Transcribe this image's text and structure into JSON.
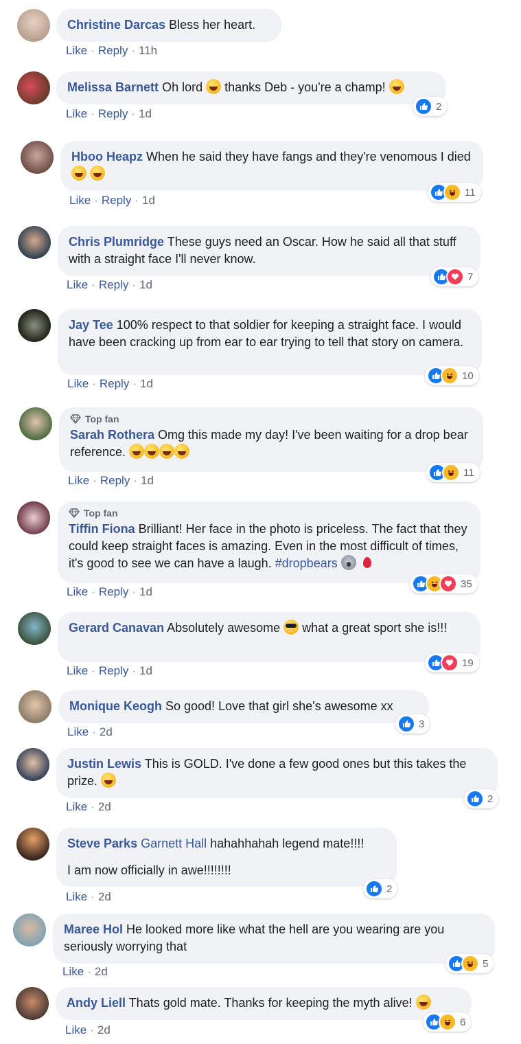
{
  "comments": [
    {
      "name": "Christine Darcas",
      "text": " Bless her heart.",
      "like": "Like",
      "reply": "Reply",
      "time": "11h",
      "reactions": null
    },
    {
      "name": "Melissa Barnett",
      "text": " Oh lord ",
      "text2": " thanks Deb - you're a champ! ",
      "like": "Like",
      "reply": "Reply",
      "time": "1d",
      "reactions": {
        "count": "2"
      }
    },
    {
      "name": "Hboo Heapz",
      "text": " When he said they have fangs and they're venomous I died ",
      "like": "Like",
      "reply": "Reply",
      "time": "1d",
      "reactions": {
        "count": "11"
      }
    },
    {
      "name": "Chris Plumridge",
      "text": " These guys need an Oscar. How he said all that stuff with a straight face I'll never know.",
      "like": "Like",
      "reply": "Reply",
      "time": "1d",
      "reactions": {
        "count": "7"
      }
    },
    {
      "name": "Jay Tee",
      "text": " 100% respect to that soldier for keeping a straight face. I would have been cracking up from ear to ear trying to tell that story on camera.",
      "like": "Like",
      "reply": "Reply",
      "time": "1d",
      "reactions": {
        "count": "10"
      }
    },
    {
      "badge": "Top fan",
      "name": "Sarah Rothera",
      "text": " Omg this made my day! I've been waiting for a drop bear reference. ",
      "like": "Like",
      "reply": "Reply",
      "time": "1d",
      "reactions": {
        "count": "11"
      }
    },
    {
      "badge": "Top fan",
      "name": "Tiffin Fiona",
      "text": " Brilliant! Her face in the photo is priceless. The fact that they could keep straight faces is amazing. Even in the most difficult of times, it's good to see we can have a laugh. ",
      "hashtag": "#dropbears",
      "like": "Like",
      "reply": "Reply",
      "time": "1d",
      "reactions": {
        "count": "35"
      }
    },
    {
      "name": "Gerard Canavan",
      "text": " Absolutely awesome ",
      "text2": " what a great sport she is!!!",
      "like": "Like",
      "reply": "Reply",
      "time": "1d",
      "reactions": {
        "count": "19"
      }
    },
    {
      "name": "Monique Keogh",
      "text": " So good! Love that girl she's awesome xx",
      "like": "Like",
      "time": "2d",
      "reactions": {
        "count": "3"
      }
    },
    {
      "name": "Justin Lewis",
      "text": " This is GOLD. I've done a few good ones but this takes the prize. ",
      "like": "Like",
      "time": "2d",
      "reactions": {
        "count": "2"
      }
    },
    {
      "name": "Steve Parks",
      "mention": "Garnett Hall",
      "text": " hahahhahah legend mate!!!!",
      "text2": "I am now officially in awe!!!!!!!!",
      "like": "Like",
      "time": "2d",
      "reactions": {
        "count": "2"
      }
    },
    {
      "name": "Maree Hol",
      "text": " He looked more like what the hell are you wearing are you seriously worrying that",
      "like": "Like",
      "time": "2d",
      "reactions": {
        "count": "5"
      }
    },
    {
      "name": "Andy Liell",
      "text": " Thats gold mate. Thanks for keeping the myth alive! ",
      "like": "Like",
      "time": "2d",
      "reactions": {
        "count": "6"
      }
    }
  ],
  "colors": {
    "name": "#385898",
    "bubble": "#f0f2f5",
    "like": "#1877f2",
    "haha": "#f7b928",
    "love": "#f33e58"
  }
}
